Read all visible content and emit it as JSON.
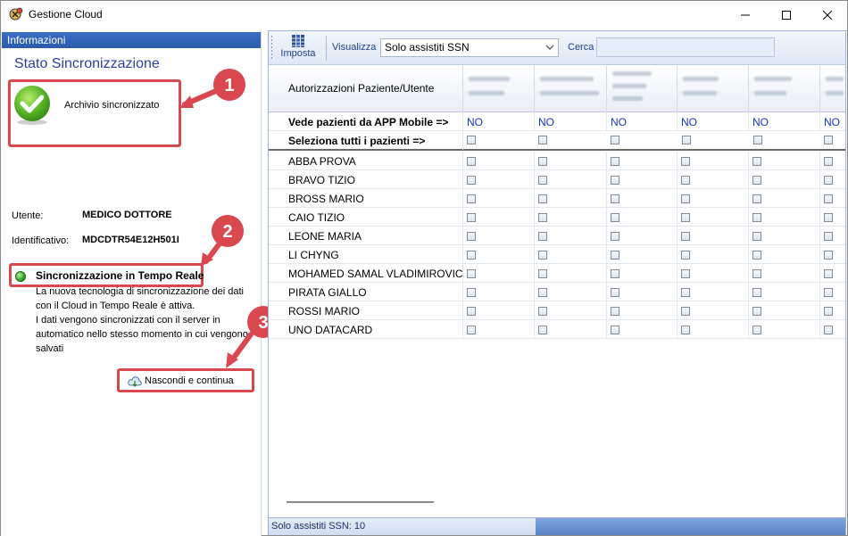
{
  "window": {
    "title": "Gestione Cloud"
  },
  "left_panel": {
    "header": "Informazioni",
    "stato_title": "Stato Sincronizzazione",
    "archivio_status": "Archivio sincronizzato",
    "utente_label": "Utente:",
    "utente_value": "MEDICO DOTTORE",
    "identificativo_label": "Identificativo:",
    "identificativo_value": "MDCDTR54E12H501I",
    "sync_title": "Sincronizzazione in Tempo Reale",
    "sync_description": "La nuova tecnologia di sincronizzazione dei dati con il Cloud in Tempo Reale è attiva.\nI dati vengono sincronizzati con il server in automatico nello stesso momento in cui vengono salvati",
    "nascondi_button": "Nascondi e continua",
    "callouts": [
      "1",
      "2",
      "3"
    ]
  },
  "toolbar": {
    "imposta_label": "Imposta",
    "visualizza_label": "Visualizza",
    "visualizza_value": "Solo assistiti SSN",
    "cerca_label": "Cerca",
    "cerca_value": ""
  },
  "grid": {
    "header_first": "Autorizzazioni Paziente/Utente",
    "app_row_label": "Vede pazienti da APP Mobile =>",
    "app_row_values": [
      "NO",
      "NO",
      "NO",
      "NO",
      "NO",
      "NO"
    ],
    "select_all_label": "Seleziona tutti i pazienti =>",
    "patients": [
      "ABBA PROVA",
      "BRAVO TIZIO",
      "BROSS MARIO",
      "CAIO TIZIO",
      "LEONE MARIA",
      "LI CHYNG",
      "MOHAMED SAMAL VLADIMIROVIC...",
      "PIRATA GIALLO",
      "ROSSI MARIO",
      "UNO DATACARD"
    ]
  },
  "statusbar": {
    "text": "Solo assistiti SSN: 10"
  },
  "colors": {
    "callout_red": "#d9474f",
    "header_blue": "#2a5aab",
    "no_blue": "#1a2fd0"
  }
}
